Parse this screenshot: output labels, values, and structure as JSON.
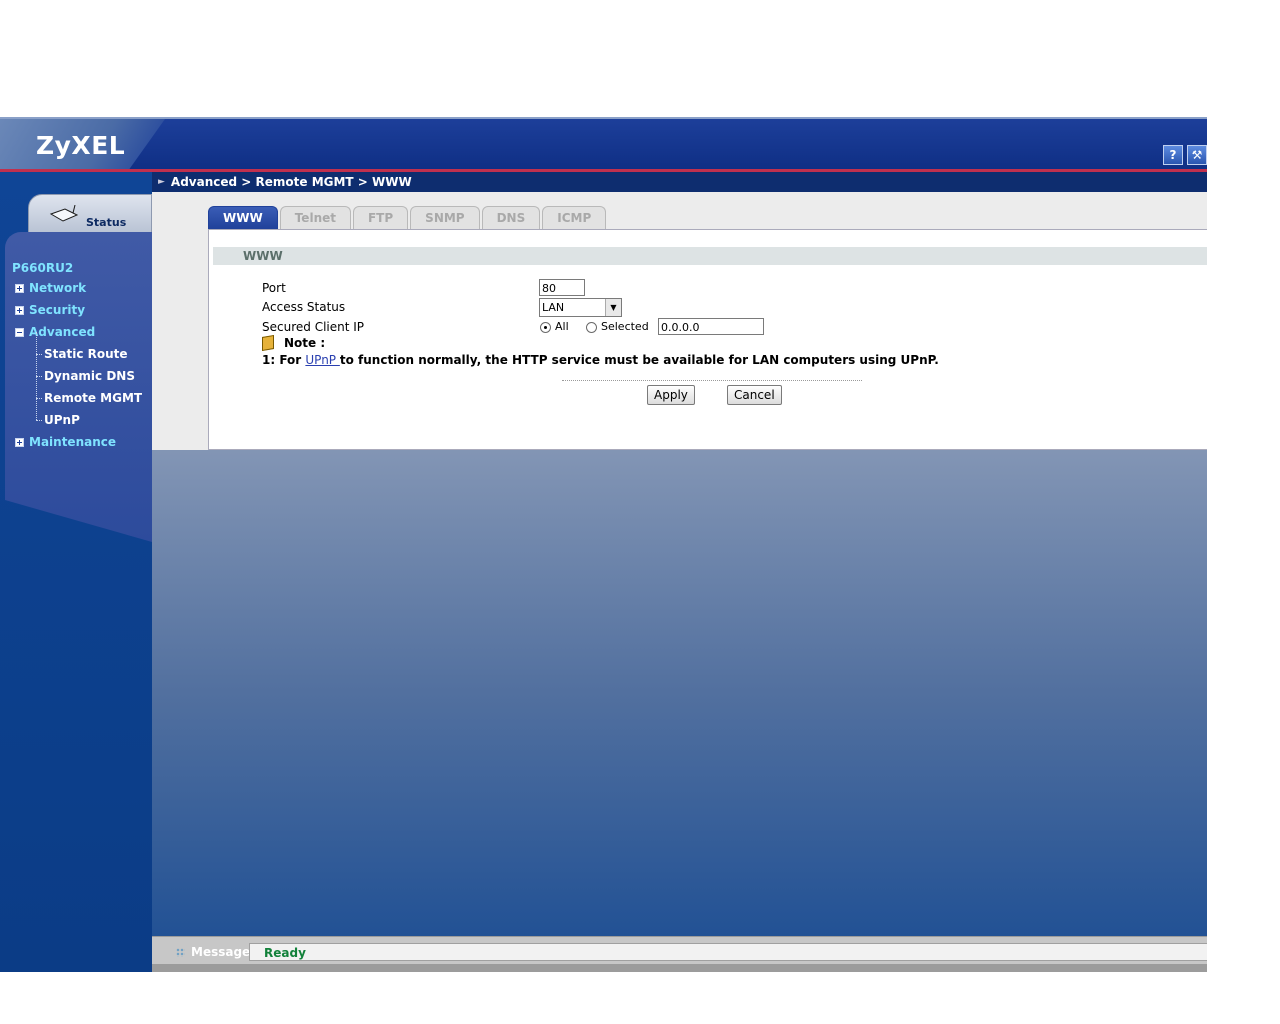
{
  "header": {
    "logo": "ZyXEL",
    "icons": [
      "help-icon",
      "wizard-icon"
    ],
    "help_label": "?",
    "wizard_label": "⚒"
  },
  "sidebar": {
    "status_tab": "Status",
    "device": "P660RU2",
    "items": [
      {
        "label": "Network",
        "state": "collapsed"
      },
      {
        "label": "Security",
        "state": "collapsed"
      },
      {
        "label": "Advanced",
        "state": "expanded"
      },
      {
        "label": "Maintenance",
        "state": "collapsed"
      }
    ],
    "advanced_subitems": [
      "Static Route",
      "Dynamic DNS",
      "Remote MGMT",
      "UPnP"
    ]
  },
  "breadcrumb": "Advanced > Remote MGMT > WWW",
  "tabs": [
    "WWW",
    "Telnet",
    "FTP",
    "SNMP",
    "DNS",
    "ICMP"
  ],
  "active_tab": "WWW",
  "section": {
    "title": "WWW"
  },
  "form": {
    "port_label": "Port",
    "port_value": "80",
    "access_label": "Access Status",
    "access_value": "LAN",
    "secured_label": "Secured Client IP",
    "radio_all": "All",
    "radio_selected": "Selected",
    "radio_checked": "All",
    "ip_value": "0.0.0.0"
  },
  "note": {
    "title": "Note :",
    "prefix": "1: For ",
    "link": "UPnP ",
    "suffix": "to function normally, the HTTP service must be available for LAN computers using UPnP."
  },
  "buttons": {
    "apply": "Apply",
    "cancel": "Cancel"
  },
  "status": {
    "label": "Message",
    "value": "Ready"
  },
  "colors": {
    "accent": "#1d3f9a",
    "nav_link": "#7fe3ff",
    "ready": "#12813a",
    "divider": "#c0304e"
  }
}
